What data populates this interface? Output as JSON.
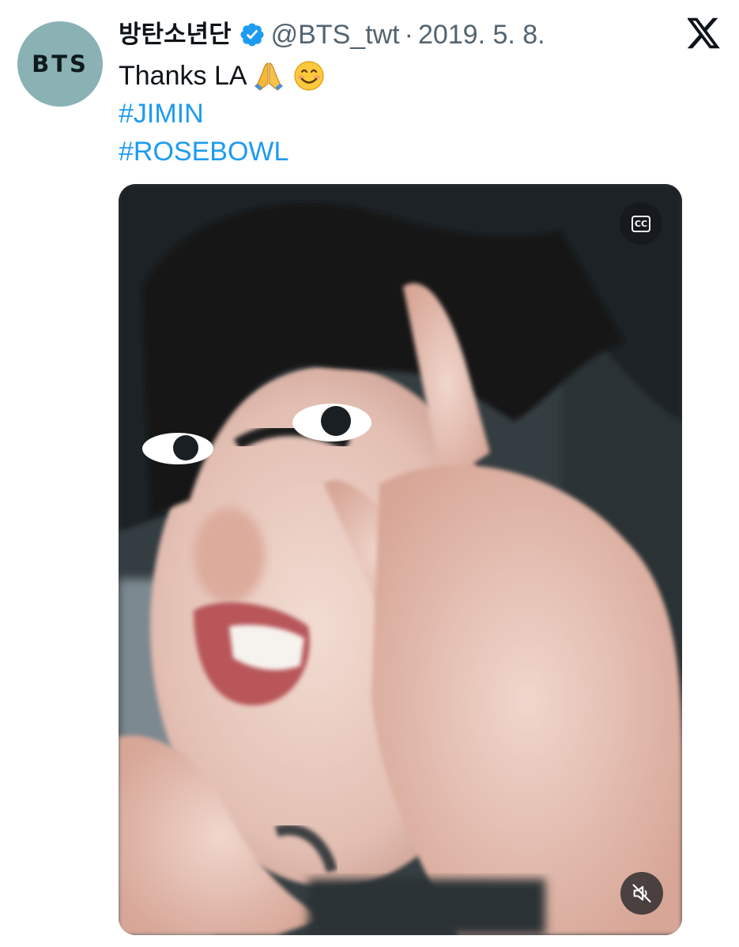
{
  "author": {
    "avatar_text": "BTS",
    "name": "방탄소년단",
    "handle": "@BTS_twt",
    "separator": "·",
    "date": "2019. 5. 8.",
    "verified": true
  },
  "tweet": {
    "text": "Thanks LA",
    "emojis": [
      "folded-hands",
      "smiling-face"
    ],
    "hashtags": [
      "#JIMIN",
      "#ROSEBOWL"
    ]
  },
  "media": {
    "type": "video",
    "captions_label": "CC",
    "muted": true
  },
  "icons": [
    "verified-badge-icon",
    "x-logo-icon",
    "closed-captions-icon",
    "muted-speaker-icon"
  ],
  "colors": {
    "link": "#1d9bf0",
    "verified": "#1d9bf0",
    "secondary_text": "#536471",
    "avatar_bg": "#8ab2b5"
  }
}
